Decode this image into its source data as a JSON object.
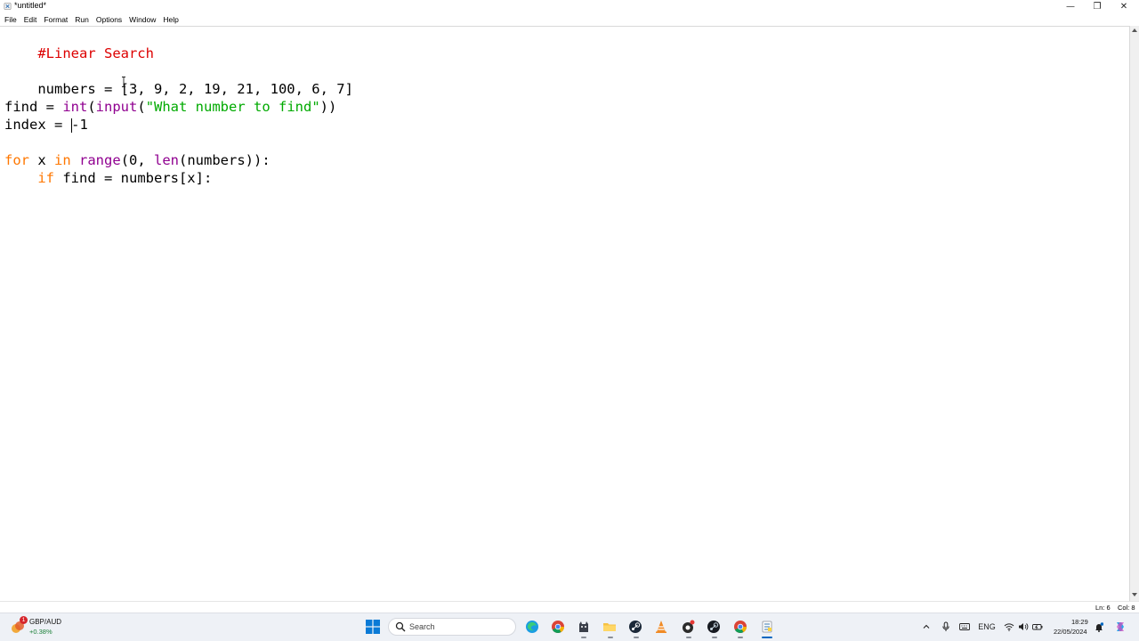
{
  "window": {
    "title": "*untitled*",
    "controls": {
      "minimize": "—",
      "maximize": "❐",
      "close": "✕"
    }
  },
  "menu": {
    "items": [
      "File",
      "Edit",
      "Format",
      "Run",
      "Options",
      "Window",
      "Help"
    ]
  },
  "editor": {
    "lines": {
      "comment": "#Linear Search",
      "numbers": "numbers = [3, 9, 2, 19, 21, 100, 6, 7]",
      "find_var": "find = ",
      "find_int": "int",
      "find_paren_open": "(",
      "find_input": "input",
      "find_paren2": "(",
      "find_string": "\"What number to find\"",
      "find_close": "))",
      "index_prefix": "index = ",
      "index_value": "-1",
      "for_kw": "for",
      "for_x": " x ",
      "for_in": "in",
      "for_space": " ",
      "for_range": "range",
      "for_args_open": "(0, ",
      "for_len": "len",
      "for_rest": "(numbers)):",
      "if_indent": "    ",
      "if_kw": "if",
      "if_rest": " find = numbers[x]:"
    }
  },
  "status": {
    "line": "Ln: 6",
    "column": "Col: 8"
  },
  "taskbar": {
    "widget": {
      "name": "GBP/AUD",
      "change": "+0.38%",
      "badge": "1"
    },
    "search_placeholder": "Search",
    "tray": {
      "language": "ENG",
      "time": "18:29",
      "date": "22/05/2024"
    }
  },
  "colors": {
    "comment": "#dd0000",
    "keyword": "#ff7700",
    "builtin": "#900090",
    "string": "#00aa00",
    "accent": "#0067c0"
  }
}
